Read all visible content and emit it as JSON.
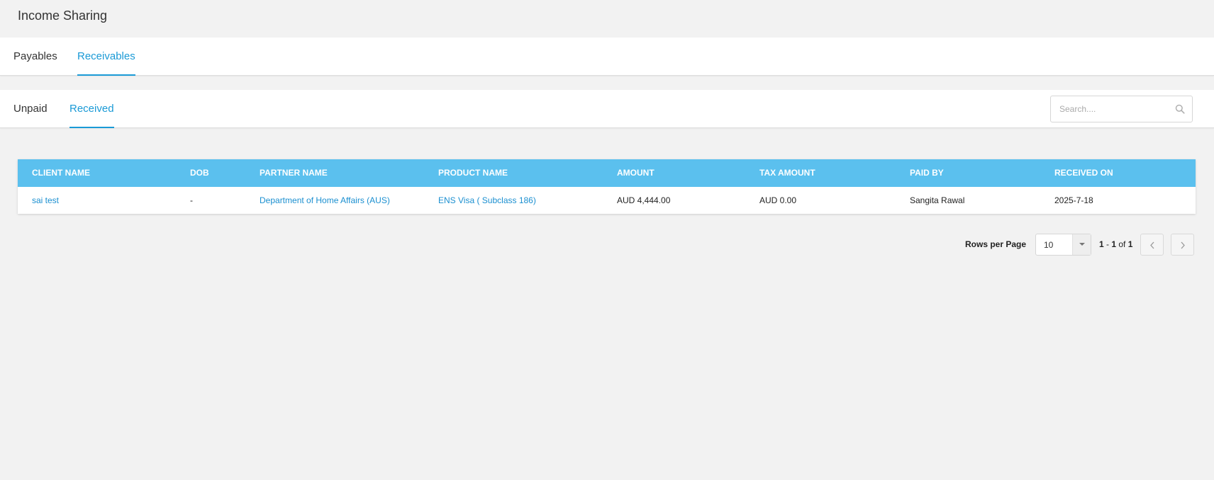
{
  "page": {
    "title": "Income Sharing"
  },
  "primary_tabs": [
    {
      "label": "Payables",
      "active": false
    },
    {
      "label": "Receivables",
      "active": true
    }
  ],
  "secondary_tabs": [
    {
      "label": "Unpaid",
      "active": false
    },
    {
      "label": "Received",
      "active": true
    }
  ],
  "search": {
    "placeholder": "Search....",
    "value": "",
    "icon": "search-icon"
  },
  "table": {
    "columns": [
      "CLIENT NAME",
      "DOB",
      "PARTNER NAME",
      "PRODUCT NAME",
      "AMOUNT",
      "TAX AMOUNT",
      "PAID BY",
      "RECEIVED ON"
    ],
    "rows": [
      {
        "client_name": "sai test",
        "dob": "-",
        "partner_name": "Department of Home Affairs (AUS)",
        "product_name": "ENS Visa ( Subclass 186)",
        "amount": "AUD 4,444.00",
        "tax_amount": "AUD 0.00",
        "paid_by": "Sangita Rawal",
        "received_on": "2025-7-18"
      }
    ]
  },
  "pagination": {
    "rows_per_page_label": "Rows per Page",
    "rows_per_page_value": "10",
    "range_start": "1",
    "range_sep": " - ",
    "range_end": "1",
    "of_label": " of ",
    "total": "1"
  },
  "colors": {
    "accent": "#1a9ad6",
    "table_header": "#5bc0ee",
    "link": "#1a8fd0",
    "background": "#f2f2f2"
  }
}
